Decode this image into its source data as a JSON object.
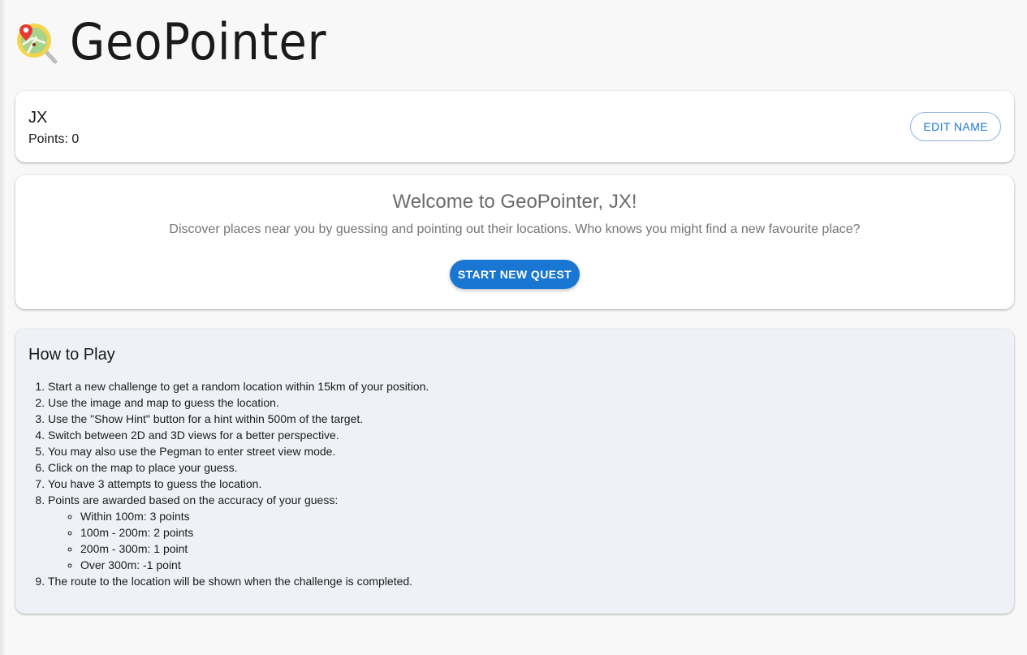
{
  "app": {
    "title": "GeoPointer",
    "logo_icon": "map-search-icon"
  },
  "user": {
    "name": "JX",
    "points": "Points: 0",
    "edit_label": "EDIT NAME"
  },
  "welcome": {
    "title": "Welcome to GeoPointer, JX!",
    "description": "Discover places near you by guessing and pointing out their locations. Who knows you might find a new favourite place?",
    "start_label": "START NEW QUEST"
  },
  "how_to_play": {
    "title": "How to Play",
    "steps": [
      "Start a new challenge to get a random location within 15km of your position.",
      "Use the image and map to guess the location.",
      "Use the \"Show Hint\" button for a hint within 500m of the target.",
      "Switch between 2D and 3D views for a better perspective.",
      "You may also use the Pegman to enter street view mode.",
      "Click on the map to place your guess.",
      "You have 3 attempts to guess the location.",
      "Points are awarded based on the accuracy of your guess:",
      "The route to the location will be shown when the challenge is completed."
    ],
    "scoring": [
      "Within 100m: 3 points",
      "100m - 200m: 2 points",
      "200m - 300m: 1 point",
      "Over 300m: -1 point"
    ]
  },
  "colors": {
    "primary": "#1976d2",
    "background": "#f8f8f8",
    "card": "#ffffff",
    "howto_background": "#eef2f7"
  }
}
